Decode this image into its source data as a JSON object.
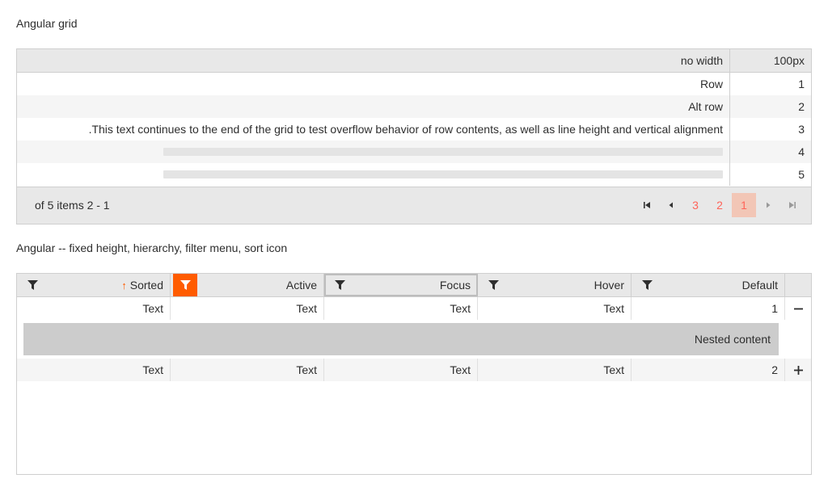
{
  "captions": {
    "first": "Angular grid",
    "second": "Angular -- fixed height, hierarchy, filter menu, sort icon"
  },
  "grid1": {
    "columns": [
      "no width",
      "100px"
    ],
    "rows": [
      {
        "text": "Row",
        "num": "1"
      },
      {
        "text": "Alt row",
        "num": "2"
      },
      {
        "text": ".This text continues to the end of the grid to test overflow behavior of row contents, as well as line height and vertical alignment",
        "num": "3"
      },
      {
        "text": "",
        "num": "4"
      },
      {
        "text": "",
        "num": "5"
      }
    ],
    "pager": {
      "info": "of 5 items 2 - 1",
      "pages": [
        "3",
        "2",
        "1"
      ],
      "selected_page": "1"
    }
  },
  "grid2": {
    "columns": [
      {
        "label": "Sorted",
        "state": "sorted"
      },
      {
        "label": "Active",
        "state": "active"
      },
      {
        "label": "Focus",
        "state": "focus"
      },
      {
        "label": "Hover",
        "state": "hover"
      },
      {
        "label": "Default",
        "state": "default"
      }
    ],
    "rows": [
      {
        "cells": [
          "Text",
          "Text",
          "Text",
          "Text",
          "1"
        ],
        "toggle": "−"
      },
      {
        "cells": [
          "Text",
          "Text",
          "Text",
          "Text",
          "2"
        ],
        "toggle": "+"
      }
    ],
    "nested_content": "Nested content"
  },
  "colors": {
    "accent": "#ff5c00",
    "page_link": "#ff6358",
    "selected_page_bg": "#f2c6b6",
    "header_bg": "#e8e8e8"
  },
  "icons": [
    "filter-icon",
    "sort-asc-icon",
    "first-page-icon",
    "prev-page-icon",
    "next-page-icon",
    "last-page-icon",
    "collapse-icon",
    "expand-icon"
  ]
}
